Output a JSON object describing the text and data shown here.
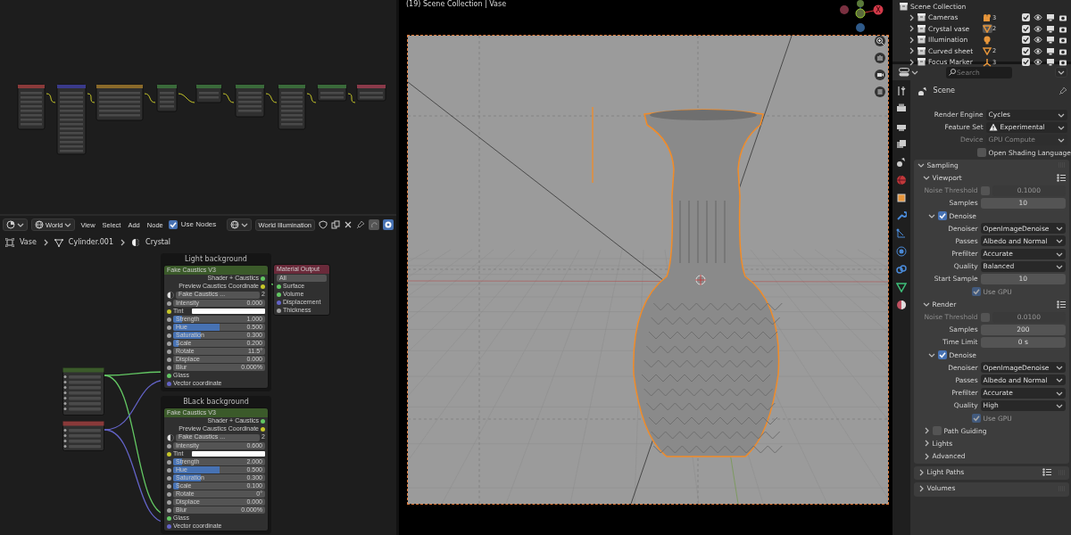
{
  "node_editor_header": {
    "world_selector": "World",
    "menus": [
      "View",
      "Select",
      "Add",
      "Node"
    ],
    "use_nodes": {
      "label": "Use Nodes",
      "checked": true
    },
    "world_name": "World Illumination"
  },
  "breadcrumb": [
    {
      "label": "Vase",
      "kind": "object"
    },
    {
      "label": "Cylinder.001",
      "kind": "mesh"
    },
    {
      "label": "Crystal",
      "kind": "material"
    }
  ],
  "frames": [
    {
      "title": "Light background",
      "node_title": "Fake Caustics V3",
      "outputs": [
        {
          "label": "Shader + Caustics",
          "kind": "shader"
        },
        {
          "label": "Preview Caustics Coordinate",
          "kind": "color"
        }
      ],
      "datablock": "Fake Caustics ...",
      "datablock_users": "2",
      "fields": [
        {
          "label": "Intensity",
          "value": "0.000",
          "level": 0
        },
        {
          "label": "Tint",
          "kind": "color"
        },
        {
          "label": "Strength",
          "value": "1.000",
          "level": 0.1
        },
        {
          "label": "Hue",
          "value": "0.500",
          "level": 0.5
        },
        {
          "label": "Saturation",
          "value": "0.300",
          "level": 0.3
        },
        {
          "label": "Scale",
          "value": "0.200",
          "level": 0.06
        },
        {
          "label": "Rotate",
          "value": "11.5°",
          "level": 0
        },
        {
          "label": "Displace",
          "value": "0.000",
          "level": 0
        },
        {
          "label": "Blur",
          "value": "0.000%",
          "level": 0
        }
      ],
      "inputs": [
        {
          "label": "Glass",
          "kind": "shader"
        },
        {
          "label": "Vector coordinate",
          "kind": "vector"
        }
      ]
    },
    {
      "title": "BLack background",
      "node_title": "Fake Caustics V3",
      "outputs": [
        {
          "label": "Shader + Caustics",
          "kind": "shader"
        },
        {
          "label": "Preview Caustics Coordinate",
          "kind": "color"
        }
      ],
      "datablock": "Fake Caustics ...",
      "datablock_users": "2",
      "fields": [
        {
          "label": "Intensity",
          "value": "0.600",
          "level": 0
        },
        {
          "label": "Tint",
          "kind": "color"
        },
        {
          "label": "Strength",
          "value": "2.000",
          "level": 0.1
        },
        {
          "label": "Hue",
          "value": "0.500",
          "level": 0.5
        },
        {
          "label": "Saturation",
          "value": "0.300",
          "level": 0.3
        },
        {
          "label": "Scale",
          "value": "0.100",
          "level": 0.06
        },
        {
          "label": "Rotate",
          "value": "0°",
          "level": 0
        },
        {
          "label": "Displace",
          "value": "0.000",
          "level": 0
        },
        {
          "label": "Blur",
          "value": "0.000%",
          "level": 0
        }
      ],
      "inputs": [
        {
          "label": "Glass",
          "kind": "shader"
        },
        {
          "label": "Vector coordinate",
          "kind": "vector"
        }
      ]
    }
  ],
  "material_output": {
    "title": "Material Output",
    "target": "All",
    "inputs": [
      {
        "label": "Surface",
        "kind": "shader"
      },
      {
        "label": "Volume",
        "kind": "shader"
      },
      {
        "label": "Displacement",
        "kind": "vector"
      },
      {
        "label": "Thickness",
        "kind": "float"
      }
    ]
  },
  "viewport": {
    "title": "(19) Scene Collection | Vase",
    "gizmo_label": "X"
  },
  "outliner": {
    "root": "Scene Collection",
    "items": [
      {
        "name": "Cameras",
        "kind": "camera",
        "count": "3",
        "active": false,
        "checked": true
      },
      {
        "name": "Crystal vase",
        "kind": "mesh",
        "count": "2",
        "active": true,
        "checked": true
      },
      {
        "name": "Illumination",
        "kind": "light",
        "active": false,
        "checked": true
      },
      {
        "name": "Curved sheet",
        "kind": "mesh",
        "count": "2",
        "active": false,
        "checked": true
      },
      {
        "name": "Focus Marker",
        "kind": "empty",
        "count": "3",
        "active": false,
        "checked": true
      }
    ]
  },
  "properties": {
    "search_placeholder": "Search",
    "context": "Scene",
    "items": [
      {
        "kind": "select",
        "label": "Render Engine",
        "value": "Cycles",
        "disabled": false,
        "warning": false
      },
      {
        "kind": "select",
        "label": "Feature Set",
        "value": "Experimental",
        "disabled": false,
        "warning": true
      },
      {
        "kind": "select",
        "label": "Device",
        "value": "GPU Compute",
        "disabled": true,
        "warning": false
      },
      {
        "kind": "checkbox",
        "label": "Open Shading Language",
        "checked": false,
        "disabled": false
      },
      {
        "kind": "group",
        "label": "Sampling",
        "expanded": true,
        "list_icon": false,
        "children": [
          {
            "kind": "group",
            "label": "Viewport",
            "expanded": true,
            "list_icon": true,
            "children": [
              {
                "kind": "number",
                "label": "Noise Threshold",
                "value": "0.1000",
                "toggle": false,
                "disabled": true
              },
              {
                "kind": "number",
                "label": "Samples",
                "value": "10",
                "disabled": false
              },
              {
                "kind": "group",
                "label": "Denoise",
                "checkbox": true,
                "expanded": true,
                "list_icon": false,
                "children": [
                  {
                    "kind": "select",
                    "label": "Denoiser",
                    "value": "OpenImageDenoise",
                    "disabled": false,
                    "warning": false
                  },
                  {
                    "kind": "select",
                    "label": "Passes",
                    "value": "Albedo and Normal",
                    "disabled": false,
                    "warning": false
                  },
                  {
                    "kind": "select",
                    "label": "Prefilter",
                    "value": "Accurate",
                    "disabled": false,
                    "warning": false
                  },
                  {
                    "kind": "select",
                    "label": "Quality",
                    "value": "Balanced",
                    "disabled": false,
                    "warning": false
                  },
                  {
                    "kind": "number",
                    "label": "Start Sample",
                    "value": "10",
                    "disabled": false
                  },
                  {
                    "kind": "checkbox",
                    "label": "Use GPU",
                    "checked": true,
                    "disabled": true
                  }
                ]
              }
            ]
          },
          {
            "kind": "group",
            "label": "Render",
            "expanded": true,
            "list_icon": true,
            "children": [
              {
                "kind": "number",
                "label": "Noise Threshold",
                "value": "0.0100",
                "toggle": false,
                "disabled": true
              },
              {
                "kind": "number",
                "label": "Samples",
                "value": "200",
                "disabled": false
              },
              {
                "kind": "number",
                "label": "Time Limit",
                "value": "0 s",
                "disabled": false
              },
              {
                "kind": "group",
                "label": "Denoise",
                "checkbox": true,
                "expanded": true,
                "list_icon": false,
                "children": [
                  {
                    "kind": "select",
                    "label": "Denoiser",
                    "value": "OpenImageDenoise",
                    "disabled": false,
                    "warning": false
                  },
                  {
                    "kind": "select",
                    "label": "Passes",
                    "value": "Albedo and Normal",
                    "disabled": false,
                    "warning": false
                  },
                  {
                    "kind": "select",
                    "label": "Prefilter",
                    "value": "Accurate",
                    "disabled": false,
                    "warning": false
                  },
                  {
                    "kind": "select",
                    "label": "Quality",
                    "value": "High",
                    "disabled": false,
                    "warning": false
                  },
                  {
                    "kind": "checkbox",
                    "label": "Use GPU",
                    "checked": true,
                    "disabled": true
                  }
                ]
              }
            ]
          },
          {
            "kind": "group",
            "label": "Path Guiding",
            "checkbox": false,
            "expanded": false,
            "list_icon": false
          },
          {
            "kind": "group",
            "label": "Lights",
            "expanded": false,
            "list_icon": false
          },
          {
            "kind": "group",
            "label": "Advanced",
            "expanded": false,
            "list_icon": false
          }
        ]
      },
      {
        "kind": "group",
        "label": "Light Paths",
        "expanded": false,
        "list_icon": true
      },
      {
        "kind": "group",
        "label": "Volumes",
        "expanded": false,
        "list_icon": false
      }
    ]
  }
}
